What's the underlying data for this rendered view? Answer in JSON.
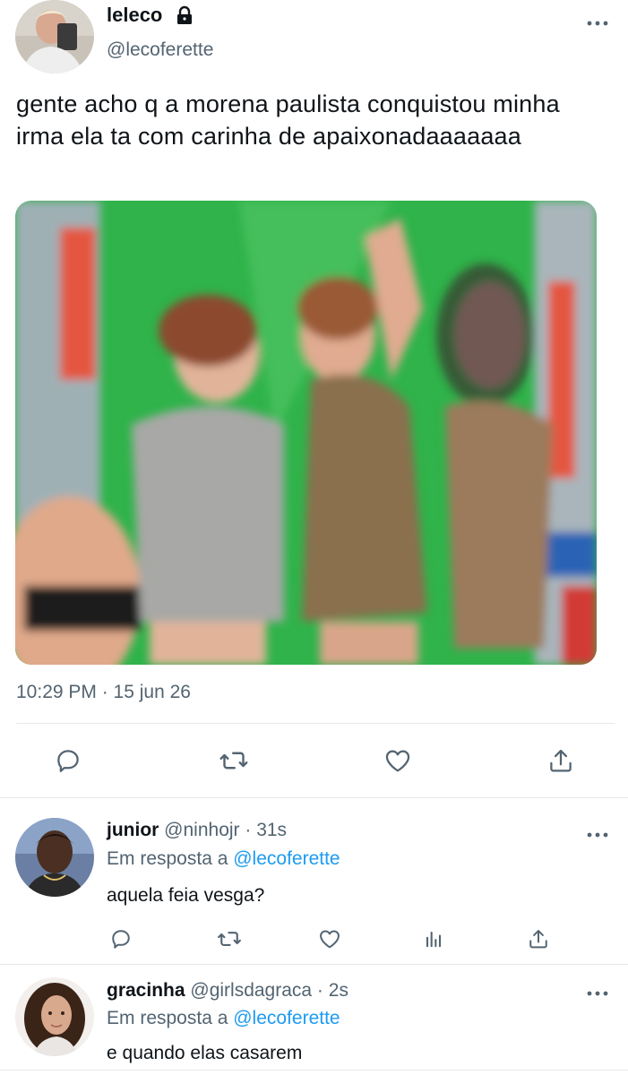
{
  "main_tweet": {
    "display_name": "leleco",
    "handle": "@lecoferette",
    "text": "gente acho q a morena paulista conquistou minha irma ela ta com carinha de apaixonadaaaaaaa",
    "timestamp": "10:29 PM · 15 jun 26",
    "icons": [
      "lock-icon",
      "more-icon",
      "reply-icon",
      "retweet-icon",
      "like-icon",
      "share-icon"
    ]
  },
  "replies": [
    {
      "display_name": "junior",
      "handle": "@ninhojr",
      "separator": " · ",
      "time": "31s",
      "replying_prefix": "Em resposta a ",
      "replying_to": "@lecoferette",
      "text": "aquela feia vesga?"
    },
    {
      "display_name": "gracinha",
      "handle": "@girlsdagraca",
      "separator": " · ",
      "time": "2s",
      "replying_prefix": "Em resposta a ",
      "replying_to": "@lecoferette",
      "text": "e quando elas casarem"
    }
  ],
  "colors": {
    "text": "#0f1419",
    "secondary": "#536471",
    "link": "#1d9bf0",
    "divider": "#e6e9eb"
  }
}
